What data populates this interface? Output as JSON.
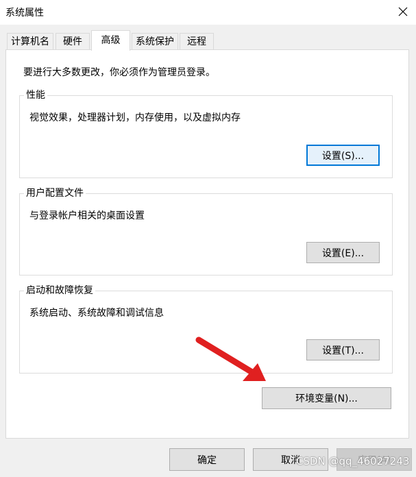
{
  "window": {
    "title": "系统属性"
  },
  "tabs": [
    {
      "label": "计算机名"
    },
    {
      "label": "硬件"
    },
    {
      "label": "高级"
    },
    {
      "label": "系统保护"
    },
    {
      "label": "远程"
    }
  ],
  "active_tab": "高级",
  "notice": "要进行大多数更改，你必须作为管理员登录。",
  "groups": {
    "performance": {
      "title": "性能",
      "description": "视觉效果，处理器计划，内存使用，以及虚拟内存",
      "button": "设置(S)..."
    },
    "user_profiles": {
      "title": "用户配置文件",
      "description": "与登录帐户相关的桌面设置",
      "button": "设置(E)..."
    },
    "startup_recovery": {
      "title": "启动和故障恢复",
      "description": "系统启动、系统故障和调试信息",
      "button": "设置(T)..."
    }
  },
  "env_button": "环境变量(N)...",
  "footer": {
    "ok": "确定",
    "cancel": "取消",
    "apply": "应用(A)"
  },
  "watermark": "CSDN @qq_46027243",
  "colors": {
    "focus_border": "#0078d7",
    "annotation_arrow": "#e02020"
  }
}
